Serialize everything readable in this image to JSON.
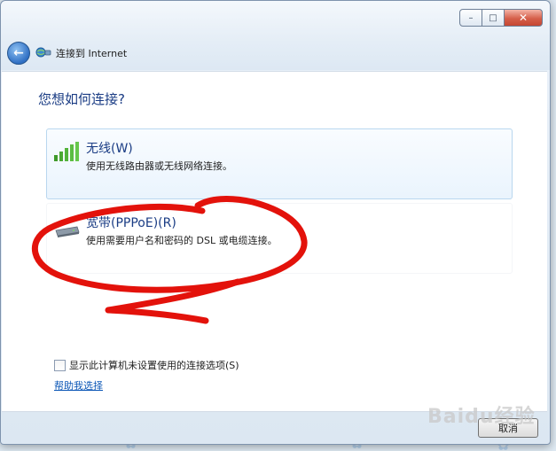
{
  "window": {
    "title": "连接到 Internet",
    "question": "您想如何连接?",
    "caption_buttons": {
      "minimize": "–",
      "maximize": "□",
      "close": "✕"
    },
    "back_icon": "back-arrow-icon"
  },
  "options": [
    {
      "id": "wireless",
      "title": "无线(W)",
      "description": "使用无线路由器或无线网络连接。",
      "icon": "wireless-signal-icon"
    },
    {
      "id": "broadband",
      "title": "宽带(PPPoE)(R)",
      "description": "使用需要用户名和密码的 DSL 或电缆连接。",
      "icon": "broadband-modem-icon"
    }
  ],
  "show_other_checkbox": {
    "label": "显示此计算机未设置使用的连接选项(S)",
    "checked": false
  },
  "help_link": "帮助我选择",
  "footer": {
    "cancel_label": "取消"
  },
  "watermark": {
    "text": "Baidu经验"
  },
  "colors": {
    "accent": "#1a3c84",
    "link": "#0b56b6",
    "annotation": "#e3120b"
  }
}
